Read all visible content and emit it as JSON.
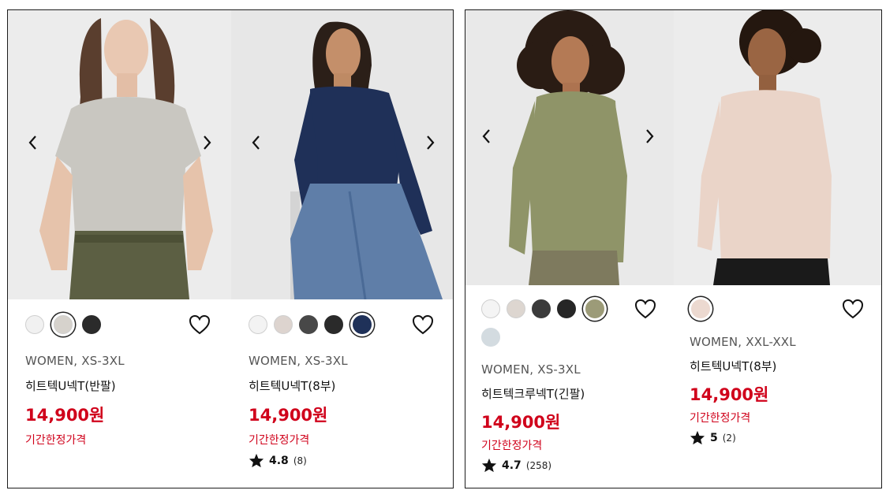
{
  "colors": {
    "price_red": "#d0021b",
    "border": "#1c1c1c"
  },
  "products": [
    {
      "size": "WOMEN, XS-3XL",
      "name": "히트텍U넥T(반팔)",
      "price": "14,900원",
      "tag": "기간한정가격",
      "swatches": [
        "#f1f1f1",
        "#d6d2cc",
        "#2b2b2b"
      ],
      "selected_swatch": 1,
      "prev_icon": "chevron-left-icon",
      "next_icon": "chevron-right-icon"
    },
    {
      "size": "WOMEN, XS-3XL",
      "name": "히트텍U넥T(8부)",
      "price": "14,900원",
      "tag": "기간한정가격",
      "rating": "4.8",
      "review_count": "(8)",
      "swatches": [
        "#f3f3f3",
        "#ddd4cf",
        "#484848",
        "#2a2a2a",
        "#1f3159"
      ],
      "selected_swatch": 4,
      "prev_icon": "chevron-left-icon",
      "next_icon": "chevron-right-icon"
    },
    {
      "size": "WOMEN, XS-3XL",
      "name": "히트텍크루넥T(긴팔)",
      "price": "14,900원",
      "tag": "기간한정가격",
      "rating": "4.7",
      "review_count": "(258)",
      "swatches": [
        "#f4f4f4",
        "#ddd6d0",
        "#3b3b3b",
        "#262626",
        "#9c9b78",
        "#d3dbe0"
      ],
      "selected_swatch": 4,
      "prev_icon": "chevron-left-icon",
      "next_icon": "chevron-right-icon"
    },
    {
      "size": "WOMEN, XXL-XXL",
      "name": "히트텍U넥T(8부)",
      "price": "14,900원",
      "tag": "기간한정가격",
      "rating": "5",
      "review_count": "(2)",
      "swatches": [
        "#ecd9d0"
      ],
      "selected_swatch": 0
    }
  ]
}
